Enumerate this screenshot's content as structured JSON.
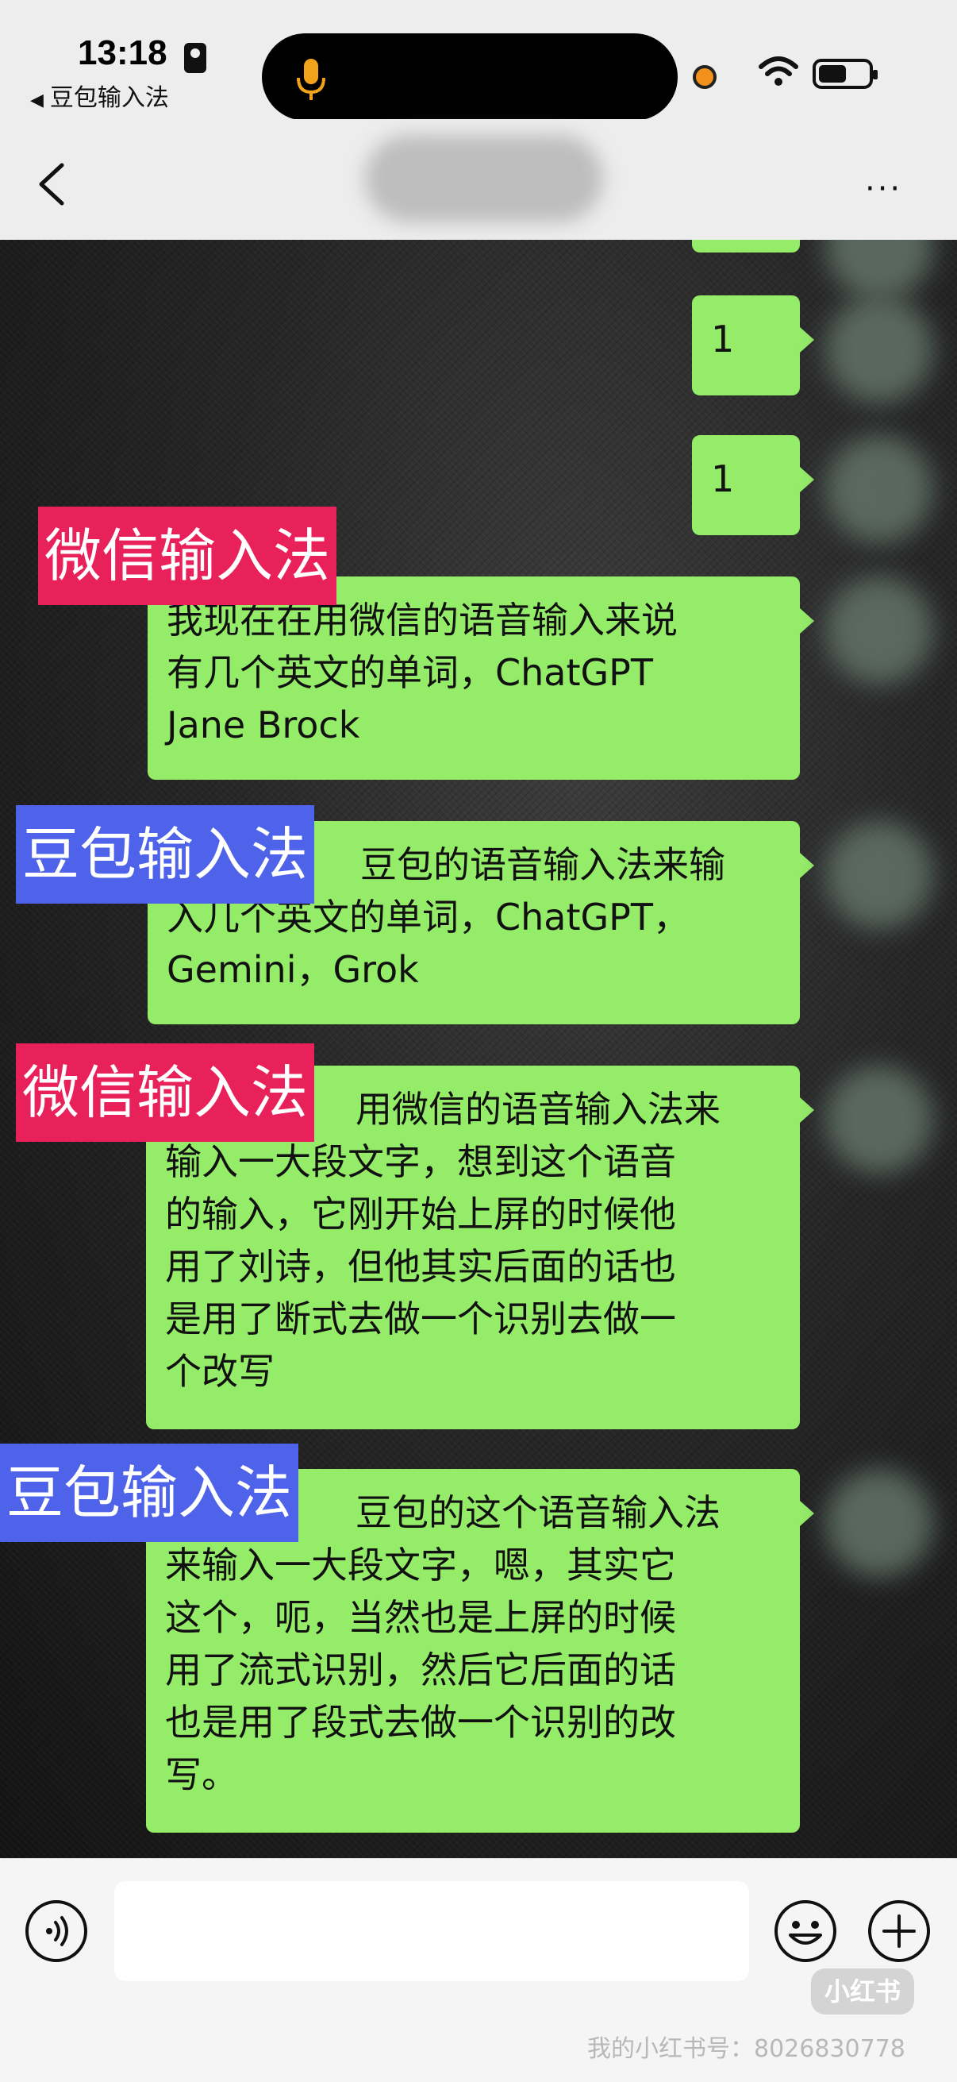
{
  "status_bar": {
    "time": "13:18",
    "back_app": "豆包输入法",
    "icons": [
      "id-card-icon",
      "microphone-icon",
      "recording-dot",
      "wifi-icon",
      "battery-icon"
    ]
  },
  "nav": {
    "title": "",
    "more_label": "···"
  },
  "messages": [
    {
      "lines": [
        "1"
      ]
    },
    {
      "lines": [
        "1"
      ]
    },
    {
      "lines": [
        "我现在在用微信的语音输入来说",
        "有几个英文的单词，ChatGPT",
        "Jane Brock"
      ]
    },
    {
      "lines": [
        "豆包的语音输入法来输",
        "入几个英文的单词，ChatGPT，",
        "Gemini，Grok"
      ]
    },
    {
      "lines": [
        "用微信的语音输入法来",
        "输入一大段文字，想到这个语音",
        "的输入，它刚开始上屏的时候他",
        "用了刘诗，但他其实后面的话也",
        "是用了断式去做一个识别去做一",
        "个改写"
      ]
    },
    {
      "lines": [
        "豆包的这个语音输入法",
        "来输入一大段文字，嗯，其实它",
        "这个，呃，当然也是上屏的时候",
        "用了流式识别，然后它后面的话",
        "也是用了段式去做一个识别的改",
        "写。"
      ]
    }
  ],
  "tags": [
    {
      "label": "微信输入法",
      "color": "#e8215a"
    },
    {
      "label": "豆包输入法",
      "color": "#4e63ea"
    },
    {
      "label": "微信输入法",
      "color": "#e8215a"
    },
    {
      "label": "豆包输入法",
      "color": "#4e63ea"
    }
  ],
  "input_bar": {
    "placeholder": "",
    "icons": [
      "voice-icon",
      "emoji-icon",
      "plus-icon"
    ]
  },
  "watermark": {
    "logo": "小红书",
    "text": "我的小红书号：8026830778"
  },
  "colors": {
    "bubble": "#95ec69",
    "tag_red": "#e8215a",
    "tag_blue": "#4e63ea",
    "bar_bg": "#ededed"
  }
}
